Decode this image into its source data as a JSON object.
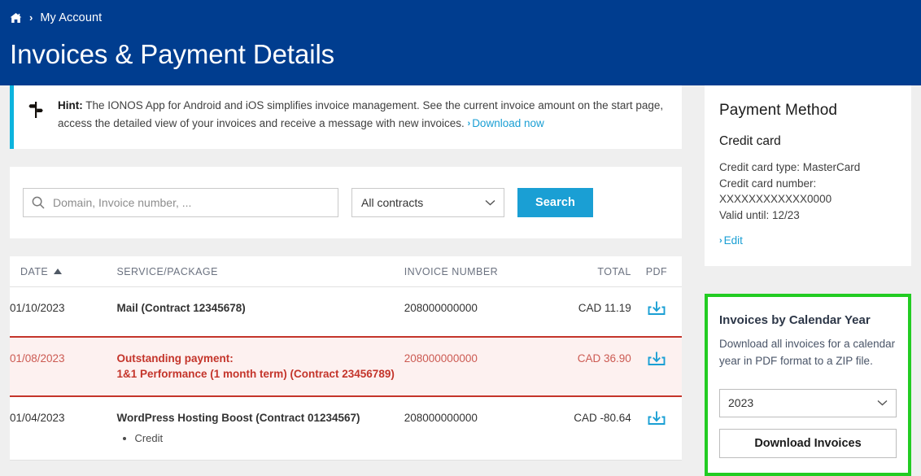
{
  "breadcrumb": {
    "home_icon": "home-icon",
    "separator": "›",
    "label": "My Account"
  },
  "header": {
    "title": "Invoices & Payment Details"
  },
  "hint": {
    "icon": "signpost-icon",
    "label": "Hint:",
    "text": " The IONOS App for Android and iOS simplifies invoice management. See the current invoice amount on the start page, access the detailed view of your invoices and receive a message with new invoices. ",
    "link_chevron": "›",
    "link_label": "Download now"
  },
  "search": {
    "icon": "search-icon",
    "placeholder": "Domain, Invoice number, ...",
    "value": "",
    "contract_selected": "All contracts",
    "contract_options": [
      "All contracts"
    ],
    "button_label": "Search"
  },
  "table": {
    "columns": [
      {
        "key": "date",
        "label": "DATE",
        "sorted": "asc"
      },
      {
        "key": "service",
        "label": "SERVICE/PACKAGE"
      },
      {
        "key": "invoice",
        "label": "INVOICE NUMBER"
      },
      {
        "key": "total",
        "label": "TOTAL"
      },
      {
        "key": "pdf",
        "label": "PDF"
      }
    ],
    "rows": [
      {
        "date": "01/10/2023",
        "service": "Mail (Contract 12345678)",
        "service_sub": "",
        "invoice": "208000000000",
        "total": "CAD 11.19",
        "total_state": "normal",
        "state": "normal",
        "pdf_icon": "download-icon"
      },
      {
        "date": "01/08/2023",
        "service": "Outstanding payment:",
        "service_line2": "1&1 Performance (1 month term) (Contract 23456789)",
        "service_sub": "",
        "invoice": "208000000000",
        "total": "CAD 36.90",
        "total_state": "normal",
        "state": "alert",
        "pdf_icon": "download-icon"
      },
      {
        "date": "01/04/2023",
        "service": "WordPress Hosting Boost (Contract 01234567)",
        "service_sub": "Credit",
        "invoice": "208000000000",
        "total": "CAD -80.64",
        "total_state": "credit",
        "state": "normal",
        "pdf_icon": "download-icon"
      }
    ]
  },
  "payment_method": {
    "title": "Payment Method",
    "subtitle": "Credit card",
    "line_type": "Credit card type: MasterCard",
    "line_number_label": "Credit card number:",
    "line_number_value": "XXXXXXXXXXXX0000",
    "line_valid": "Valid until: 12/23",
    "edit_chevron": "›",
    "edit_label": "Edit"
  },
  "calendar_year": {
    "title": "Invoices by Calendar Year",
    "description": "Download all invoices for a calendar year in PDF format to a ZIP file.",
    "year_selected": "2023",
    "year_options": [
      "2023"
    ],
    "button_label": "Download Invoices",
    "highlight_color": "#22cc22"
  },
  "colors": {
    "header_bg": "#003d8f",
    "accent_blue": "#1a9fd4",
    "hint_border": "#0cb4de",
    "alert_red": "#c4352b",
    "alert_bg": "#fdf1f0",
    "credit_green": "#2aa54a",
    "page_bg": "#efefef"
  }
}
